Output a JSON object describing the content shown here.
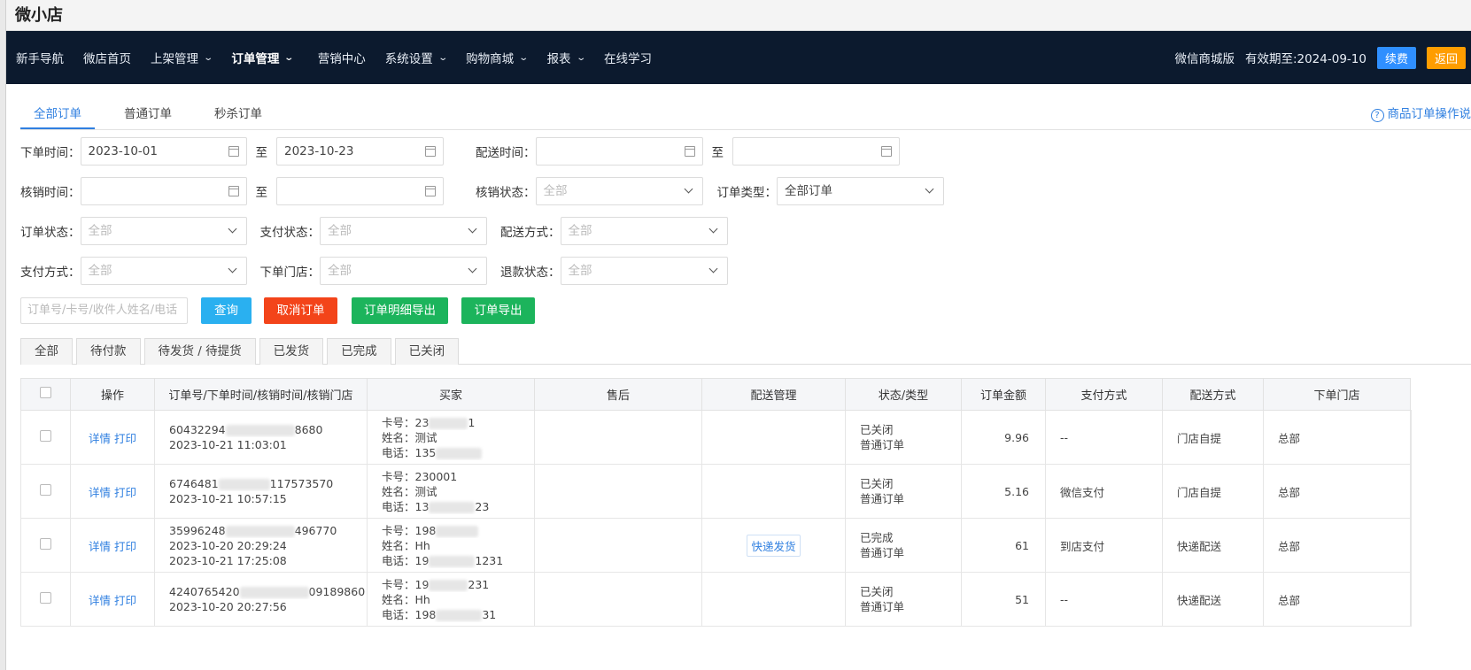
{
  "app_title": "微小店",
  "nav": {
    "items": [
      {
        "label": "新手导航",
        "dropdown": false
      },
      {
        "label": "微店首页",
        "dropdown": false
      },
      {
        "label": "上架管理",
        "dropdown": true
      },
      {
        "label": "订单管理",
        "dropdown": true
      },
      {
        "label": "营销中心",
        "dropdown": false
      },
      {
        "label": "系统设置",
        "dropdown": true
      },
      {
        "label": "购物商城",
        "dropdown": true
      },
      {
        "label": "报表",
        "dropdown": true
      },
      {
        "label": "在线学习",
        "dropdown": false
      }
    ],
    "active": "订单管理",
    "version": "微信商城版",
    "expiry": "有效期至:2024-09-10",
    "renew_label": "续费",
    "back_label": "返回"
  },
  "tabs": [
    "全部订单",
    "普通订单",
    "秒杀订单"
  ],
  "help_link": "商品订单操作说",
  "filters": {
    "order_time_label": "下单时间：",
    "order_time_from": "2023-10-01",
    "to_label": "至",
    "order_time_to": "2023-10-23",
    "delivery_time_label": "配送时间：",
    "verify_time_label": "核销时间：",
    "verify_status_label": "核销状态：",
    "verify_status_value": "全部",
    "order_type_label": "订单类型：",
    "order_type_value": "全部订单",
    "order_status_label": "订单状态：",
    "order_status_value": "全部",
    "pay_status_label": "支付状态：",
    "pay_status_value": "全部",
    "delivery_method_label": "配送方式：",
    "delivery_method_value": "全部",
    "pay_method_label": "支付方式：",
    "pay_method_value": "全部",
    "store_label": "下单门店：",
    "store_value": "全部",
    "refund_status_label": "退款状态：",
    "refund_status_value": "全部"
  },
  "search_placeholder": "订单号/卡号/收件人姓名/电话",
  "actions": {
    "query": "查询",
    "cancel": "取消订单",
    "export_detail": "订单明细导出",
    "export": "订单导出"
  },
  "colors": {
    "query": "#2ab0f0",
    "cancel": "#f3441a",
    "export": "#1cb45c"
  },
  "status_tabs": [
    "全部",
    "待付款",
    "待发货 / 待提货",
    "已发货",
    "已完成",
    "已关闭"
  ],
  "table": {
    "headers": [
      "操作",
      "订单号/下单时间/核销时间/核销门店",
      "买家",
      "售后",
      "配送管理",
      "状态/类型",
      "订单金额",
      "支付方式",
      "配送方式",
      "下单门店"
    ],
    "detail_label": "详情",
    "print_label": "打印",
    "rows": [
      {
        "order_no_a": "60432294",
        "order_no_b": "8680",
        "time1": "2023-10-21 11:03:01",
        "time2": "",
        "card_a": "卡号：23",
        "card_b": "1",
        "name": "姓名：测试",
        "phone_a": "电话：135",
        "phone_b": "",
        "ship": "",
        "status": "已关闭",
        "type": "普通订单",
        "amount": "9.96",
        "pay": "--",
        "delivery": "门店自提",
        "store": "总部"
      },
      {
        "order_no_a": "6746481",
        "order_no_b": "117573570",
        "time1": "2023-10-21 10:57:15",
        "time2": "",
        "card_a": "卡号：230001",
        "card_b": "",
        "name": "姓名：测试",
        "phone_a": "电话：13",
        "phone_b": "23",
        "ship": "",
        "status": "已关闭",
        "type": "普通订单",
        "amount": "5.16",
        "pay": "微信支付",
        "delivery": "门店自提",
        "store": "总部"
      },
      {
        "order_no_a": "35996248",
        "order_no_b": "496770",
        "time1": "2023-10-20 20:29:24",
        "time2": "2023-10-21 17:25:08",
        "card_a": "卡号：198",
        "card_b": "",
        "name": "姓名：Hh",
        "phone_a": "电话：19",
        "phone_b": "1231",
        "ship": "快递发货",
        "status": "已完成",
        "type": "普通订单",
        "amount": "61",
        "pay": "到店支付",
        "delivery": "快递配送",
        "store": "总部"
      },
      {
        "order_no_a": "4240765420",
        "order_no_b": "09189860",
        "time1": "2023-10-20 20:27:56",
        "time2": "",
        "card_a": "卡号：19",
        "card_b": "231",
        "name": "姓名：Hh",
        "phone_a": "电话：198",
        "phone_b": "31",
        "ship": "",
        "status": "已关闭",
        "type": "普通订单",
        "amount": "51",
        "pay": "--",
        "delivery": "快递配送",
        "store": "总部"
      }
    ]
  }
}
